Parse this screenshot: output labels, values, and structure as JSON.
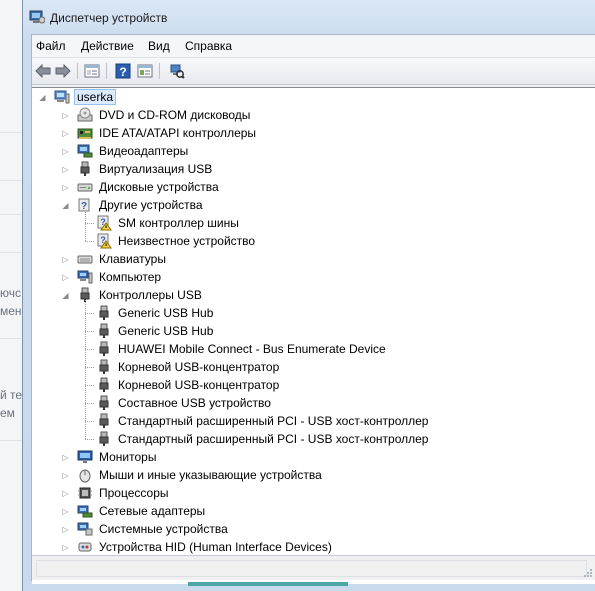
{
  "window": {
    "title": "Диспетчер устройств",
    "icon": "device-manager-icon"
  },
  "background_fragments": [
    "ючс",
    "мен",
    "й те",
    "ем"
  ],
  "menu": [
    "Файл",
    "Действие",
    "Вид",
    "Справка"
  ],
  "toolbar": {
    "buttons": [
      "back-arrow-icon",
      "forward-arrow-icon",
      "properties-icon",
      "help-icon",
      "console-tree-icon",
      "scan-hardware-icon"
    ]
  },
  "tree": {
    "root": "userka",
    "nodes": [
      {
        "label": "DVD и CD-ROM дисководы",
        "icon": "dvd-drive-icon",
        "expanded": false
      },
      {
        "label": "IDE ATA/ATAPI контроллеры",
        "icon": "ide-controller-icon",
        "expanded": false
      },
      {
        "label": "Видеоадаптеры",
        "icon": "display-adapter-icon",
        "expanded": false
      },
      {
        "label": "Виртуализация USB",
        "icon": "usb-plug-icon",
        "expanded": false
      },
      {
        "label": "Дисковые устройства",
        "icon": "disk-drive-icon",
        "expanded": false
      },
      {
        "label": "Другие устройства",
        "icon": "unknown-device-icon",
        "expanded": true,
        "children": [
          {
            "label": "SM контроллер шины",
            "icon": "unknown-device-warning-icon"
          },
          {
            "label": "Неизвестное устройство",
            "icon": "unknown-device-warning-icon"
          }
        ]
      },
      {
        "label": "Клавиатуры",
        "icon": "keyboard-icon",
        "expanded": false
      },
      {
        "label": "Компьютер",
        "icon": "computer-icon",
        "expanded": false
      },
      {
        "label": "Контроллеры USB",
        "icon": "usb-plug-icon",
        "expanded": true,
        "children": [
          {
            "label": "Generic USB Hub",
            "icon": "usb-plug-icon"
          },
          {
            "label": "Generic USB Hub",
            "icon": "usb-plug-icon"
          },
          {
            "label": "HUAWEI Mobile Connect - Bus Enumerate Device",
            "icon": "usb-plug-icon"
          },
          {
            "label": "Корневой USB-концентратор",
            "icon": "usb-plug-icon"
          },
          {
            "label": "Корневой USB-концентратор",
            "icon": "usb-plug-icon"
          },
          {
            "label": "Составное USB устройство",
            "icon": "usb-plug-icon"
          },
          {
            "label": "Стандартный расширенный PCI - USB хост-контроллер",
            "icon": "usb-plug-icon"
          },
          {
            "label": "Стандартный расширенный PCI - USB хост-контроллер",
            "icon": "usb-plug-icon"
          }
        ]
      },
      {
        "label": "Мониторы",
        "icon": "monitor-icon",
        "expanded": false
      },
      {
        "label": "Мыши и иные указывающие устройства",
        "icon": "mouse-icon",
        "expanded": false
      },
      {
        "label": "Процессоры",
        "icon": "processor-icon",
        "expanded": false
      },
      {
        "label": "Сетевые адаптеры",
        "icon": "network-adapter-icon",
        "expanded": false
      },
      {
        "label": "Системные устройства",
        "icon": "system-devices-icon",
        "expanded": false
      },
      {
        "label": "Устройства HID (Human Interface Devices)",
        "icon": "hid-icon",
        "expanded": false
      }
    ]
  },
  "status": {
    "text": ""
  }
}
